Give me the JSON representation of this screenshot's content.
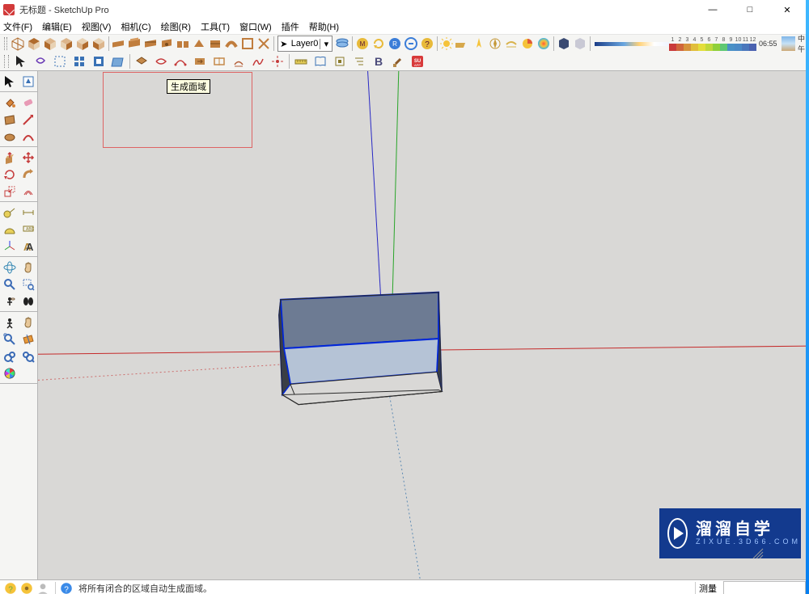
{
  "window": {
    "title": "无标题 - SketchUp Pro",
    "min_icon": "—",
    "max_icon": "□",
    "close_icon": "✕"
  },
  "menu": {
    "file": "文件(F)",
    "edit": "编辑(E)",
    "view": "视图(V)",
    "camera": "相机(C)",
    "draw": "绘图(R)",
    "tools": "工具(T)",
    "window": "窗口(W)",
    "plugins": "插件",
    "help": "帮助(H)"
  },
  "toolbar": {
    "layer_current": "Layer0",
    "time": "06:55",
    "noon": "中午",
    "palette_numbers": [
      "1",
      "2",
      "3",
      "4",
      "5",
      "6",
      "7",
      "8",
      "9",
      "10",
      "11",
      "12"
    ],
    "palette_colors": [
      "#c93a3a",
      "#d0663a",
      "#d6933a",
      "#e1be3a",
      "#e3de3a",
      "#bfd83a",
      "#8fd03a",
      "#5ec873",
      "#4990c6",
      "#4a89c6",
      "#4a77bc",
      "#4a62b0"
    ]
  },
  "viewport": {
    "tooltip": "生成面域"
  },
  "status": {
    "hint_text": "将所有闭合的区域自动生成面域。",
    "measure_label": "测量",
    "measure_value": ""
  },
  "watermark": {
    "line1": "溜溜自学",
    "line2": "ZIXUE.3D66.COM"
  },
  "icons": {
    "select": "select-icon",
    "erase": "erase-icon",
    "rect": "rect-icon",
    "line": "line-icon",
    "circle": "circle-icon",
    "arc": "arc-icon",
    "pushpull": "pushpull-icon",
    "move": "move-icon",
    "rotate": "rotate-icon",
    "scale": "scale-icon",
    "tape": "tape-icon",
    "paint": "paint-icon",
    "orbit": "orbit-icon",
    "pan": "pan-icon",
    "zoom": "zoom-icon",
    "zoom-ext": "zoom-extents-icon"
  }
}
